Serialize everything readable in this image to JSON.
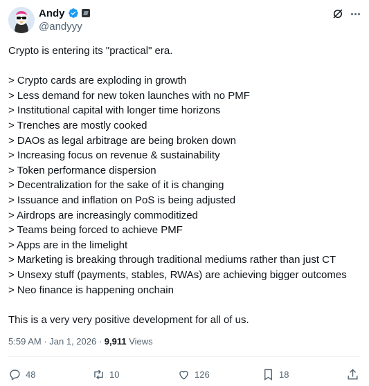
{
  "author": {
    "display_name": "Andy",
    "handle": "@andyyy"
  },
  "tweet": {
    "lines": [
      "Crypto is entering its \"practical\" era.",
      "",
      "> Crypto cards are exploding in growth",
      "> Less demand for new token launches with no PMF",
      "> Institutional capital with longer time horizons",
      "> Trenches are mostly cooked",
      "> DAOs as legal arbitrage are being broken down",
      "> Increasing focus on revenue & sustainability",
      "> Token performance dispersion",
      "> Decentralization for the sake of it is changing",
      "> Issuance and inflation on PoS is being adjusted",
      "> Airdrops are increasingly commoditized",
      "> Teams being forced to achieve PMF",
      "> Apps are in the limelight",
      "> Marketing is breaking through traditional mediums rather than just CT",
      "> Unsexy stuff (payments, stables, RWAs) are achieving bigger outcomes",
      "> Neo finance is happening onchain",
      "",
      "This is a very very positive development for all of us."
    ]
  },
  "meta": {
    "time": "5:59 AM",
    "separator": " · ",
    "date": "Jan 1, 2026",
    "views_count": "9,911",
    "views_label": " Views"
  },
  "actions": {
    "replies": "48",
    "reposts": "10",
    "likes": "126",
    "bookmarks": "18"
  },
  "colors": {
    "text": "#0f1419",
    "secondary": "#536471",
    "verified": "#1d9bf0",
    "divider": "#eff3f4"
  },
  "icons": [
    "verified-badge-icon",
    "affiliate-badge-icon",
    "grok-icon",
    "more-icon",
    "reply-icon",
    "repost-icon",
    "like-icon",
    "bookmark-icon",
    "share-icon"
  ]
}
